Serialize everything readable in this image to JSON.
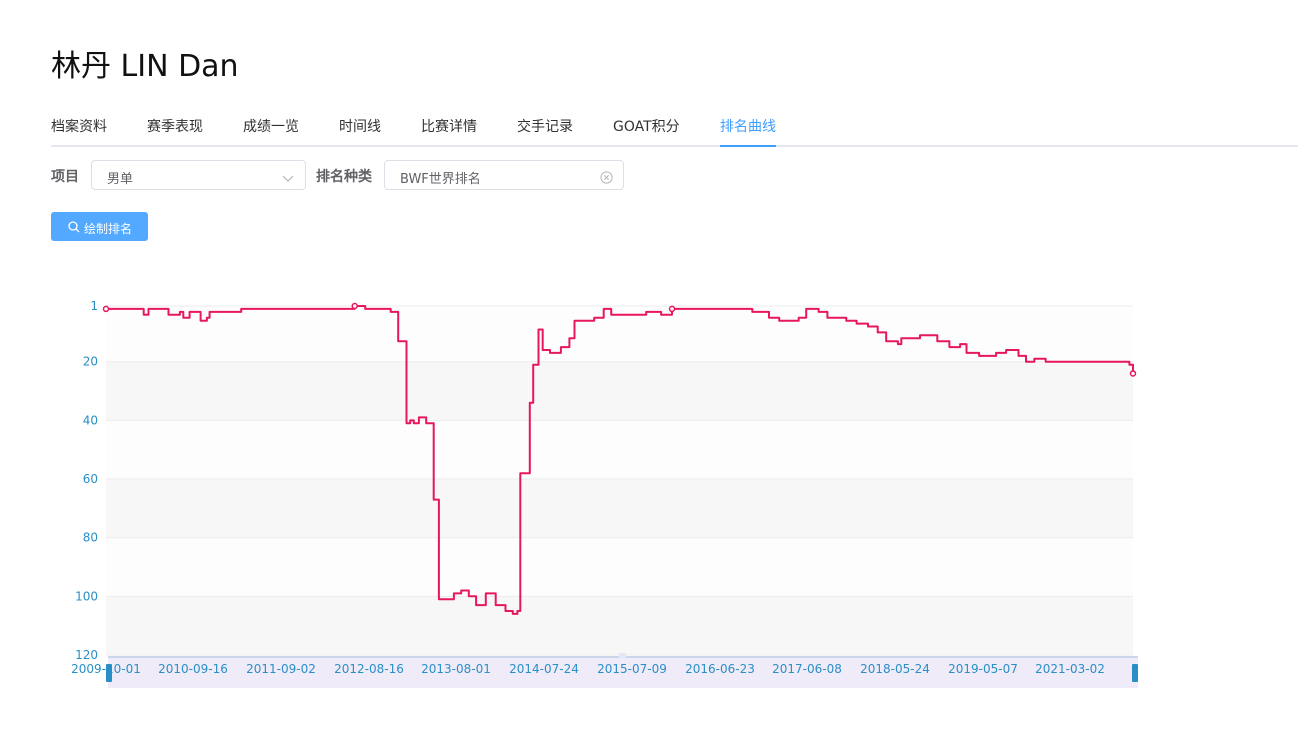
{
  "header": {
    "title": "林丹 LIN Dan"
  },
  "tabs": [
    {
      "label": "档案资料",
      "active": false
    },
    {
      "label": "赛季表现",
      "active": false
    },
    {
      "label": "成绩一览",
      "active": false
    },
    {
      "label": "时间线",
      "active": false
    },
    {
      "label": "比赛详情",
      "active": false
    },
    {
      "label": "交手记录",
      "active": false
    },
    {
      "label": "GOAT积分",
      "active": false
    },
    {
      "label": "排名曲线",
      "active": true
    }
  ],
  "filters": {
    "event_label": "项目",
    "event_value": "男单",
    "ranking_type_label": "排名种类",
    "ranking_type_value": "BWF世界排名"
  },
  "actions": {
    "draw_button": "绘制排名"
  },
  "colors": {
    "accent": "#409eff",
    "line": "#e8175d",
    "axis_text": "#2a8fc7"
  },
  "chart_data": {
    "type": "line",
    "title": "",
    "xlabel": "",
    "ylabel": "",
    "y_inverted": true,
    "ylim": [
      1,
      120
    ],
    "yticks": [
      1,
      20,
      40,
      60,
      80,
      100,
      120
    ],
    "xticks": [
      "2009-10-01",
      "2010-09-16",
      "2011-09-02",
      "2012-08-16",
      "2013-08-01",
      "2014-07-24",
      "2015-07-09",
      "2016-06-23",
      "2017-06-08",
      "2018-05-24",
      "2019-05-07",
      "2021-03-02"
    ],
    "grid": true,
    "series": [
      {
        "name": "",
        "points": [
          [
            "2009-10-01",
            2
          ],
          [
            "2010-01-10",
            2
          ],
          [
            "2010-03-01",
            2
          ],
          [
            "2010-03-05",
            4
          ],
          [
            "2010-03-25",
            2
          ],
          [
            "2010-06-10",
            2
          ],
          [
            "2010-06-15",
            4
          ],
          [
            "2010-08-01",
            3
          ],
          [
            "2010-08-15",
            5
          ],
          [
            "2010-09-10",
            3
          ],
          [
            "2010-10-15",
            3
          ],
          [
            "2010-10-25",
            6
          ],
          [
            "2010-11-20",
            5
          ],
          [
            "2010-12-01",
            3
          ],
          [
            "2011-04-10",
            2
          ],
          [
            "2011-06-01",
            2
          ],
          [
            "2011-08-20",
            2
          ],
          [
            "2012-03-10",
            2
          ],
          [
            "2012-07-20",
            1
          ],
          [
            "2012-09-01",
            2
          ],
          [
            "2012-12-15",
            3
          ],
          [
            "2013-01-15",
            13
          ],
          [
            "2013-02-10",
            13
          ],
          [
            "2013-02-18",
            41
          ],
          [
            "2013-03-05",
            40
          ],
          [
            "2013-03-20",
            41
          ],
          [
            "2013-04-10",
            39
          ],
          [
            "2013-05-10",
            41
          ],
          [
            "2013-06-10",
            67
          ],
          [
            "2013-07-01",
            101
          ],
          [
            "2013-08-01",
            101
          ],
          [
            "2013-09-01",
            99
          ],
          [
            "2013-10-01",
            98
          ],
          [
            "2013-11-01",
            100
          ],
          [
            "2013-12-01",
            103
          ],
          [
            "2014-01-10",
            99
          ],
          [
            "2014-02-20",
            103
          ],
          [
            "2014-04-01",
            105
          ],
          [
            "2014-05-01",
            106
          ],
          [
            "2014-05-20",
            105
          ],
          [
            "2014-06-01",
            58
          ],
          [
            "2014-06-20",
            58
          ],
          [
            "2014-07-10",
            34
          ],
          [
            "2014-07-24",
            21
          ],
          [
            "2014-08-15",
            9
          ],
          [
            "2014-09-01",
            16
          ],
          [
            "2014-10-01",
            17
          ],
          [
            "2014-11-15",
            15
          ],
          [
            "2014-12-20",
            12
          ],
          [
            "2015-01-10",
            6
          ],
          [
            "2015-04-01",
            5
          ],
          [
            "2015-05-10",
            2
          ],
          [
            "2015-06-10",
            4
          ],
          [
            "2015-08-01",
            4
          ],
          [
            "2015-11-01",
            3
          ],
          [
            "2016-01-01",
            4
          ],
          [
            "2016-02-15",
            2
          ],
          [
            "2016-06-01",
            2
          ],
          [
            "2016-09-01",
            2
          ],
          [
            "2017-01-10",
            3
          ],
          [
            "2017-03-20",
            5
          ],
          [
            "2017-05-01",
            6
          ],
          [
            "2017-06-01",
            6
          ],
          [
            "2017-07-20",
            5
          ],
          [
            "2017-08-20",
            2
          ],
          [
            "2017-10-10",
            3
          ],
          [
            "2017-11-15",
            5
          ],
          [
            "2018-02-01",
            6
          ],
          [
            "2018-03-15",
            7
          ],
          [
            "2018-05-01",
            8
          ],
          [
            "2018-06-10",
            10
          ],
          [
            "2018-07-15",
            13
          ],
          [
            "2018-09-01",
            14
          ],
          [
            "2018-09-15",
            12
          ],
          [
            "2018-12-01",
            11
          ],
          [
            "2019-02-10",
            13
          ],
          [
            "2019-04-01",
            15
          ],
          [
            "2019-05-15",
            14
          ],
          [
            "2019-06-10",
            17
          ],
          [
            "2019-08-01",
            18
          ],
          [
            "2019-10-10",
            17
          ],
          [
            "2019-11-20",
            16
          ],
          [
            "2020-01-10",
            18
          ],
          [
            "2020-02-10",
            20
          ],
          [
            "2020-03-15",
            19
          ],
          [
            "2020-05-01",
            20
          ],
          [
            "2020-07-01",
            20
          ],
          [
            "2021-03-02",
            20
          ],
          [
            "2021-04-10",
            21
          ],
          [
            "2021-04-25",
            24
          ]
        ]
      }
    ]
  }
}
